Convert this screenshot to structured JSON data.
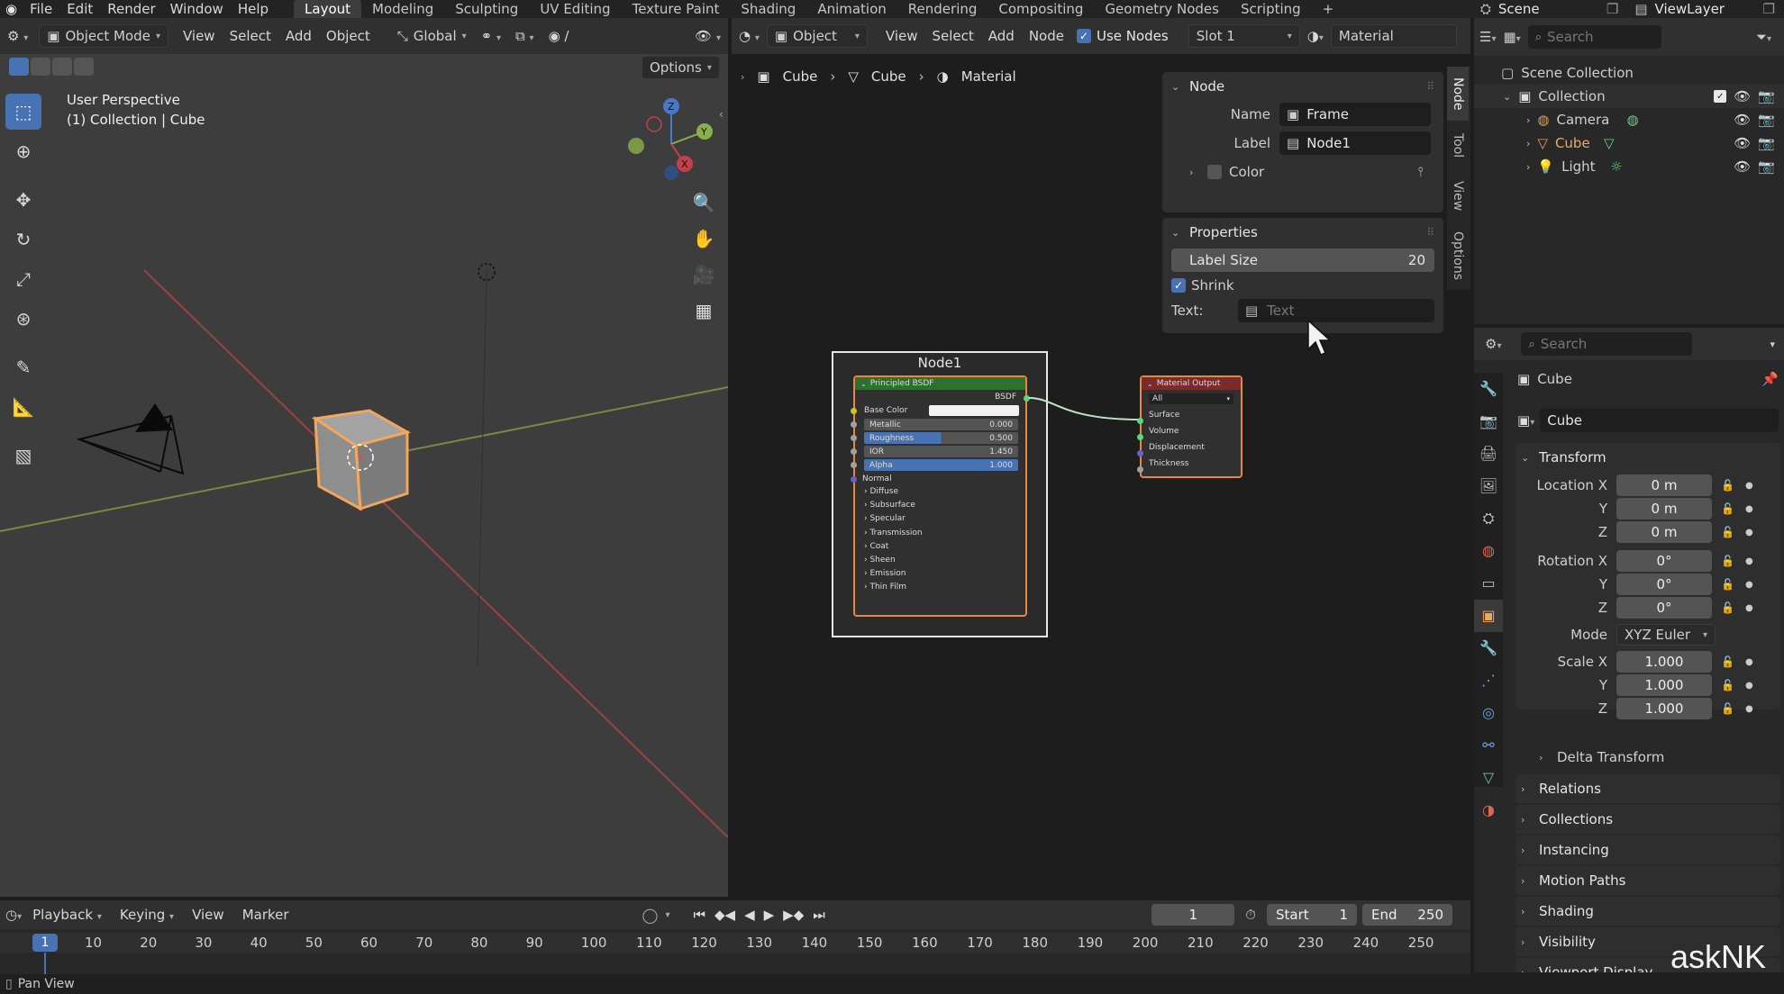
{
  "topbar": {
    "menus": [
      "File",
      "Edit",
      "Render",
      "Window",
      "Help"
    ],
    "workspaces": [
      "Layout",
      "Modeling",
      "Sculpting",
      "UV Editing",
      "Texture Paint",
      "Shading",
      "Animation",
      "Rendering",
      "Compositing",
      "Geometry Nodes",
      "Scripting"
    ],
    "active_workspace": "Layout",
    "scene": "Scene",
    "view_layer": "ViewLayer"
  },
  "viewport": {
    "mode": "Object Mode",
    "menus": [
      "View",
      "Select",
      "Add",
      "Object"
    ],
    "transform_orientation": "Global",
    "options_label": "Options",
    "info_line1": "User Perspective",
    "info_line2": "(1) Collection | Cube",
    "gizmo_axes": {
      "x": "X",
      "y": "Y",
      "z": "Z"
    }
  },
  "node_editor": {
    "type_dropdown": "Object",
    "menus": [
      "View",
      "Select",
      "Add",
      "Node"
    ],
    "use_nodes_label": "Use Nodes",
    "slot": "Slot 1",
    "material": "Material",
    "breadcrumb": [
      "Cube",
      "Cube",
      "Material"
    ],
    "sidebar_tabs": [
      "Node",
      "Tool",
      "View",
      "Options"
    ],
    "node_panel": {
      "title": "Node",
      "name_label": "Name",
      "name_value": "Frame",
      "label_label": "Label",
      "label_value": "Node1",
      "color_label": "Color"
    },
    "properties_panel": {
      "title": "Properties",
      "label_size_label": "Label Size",
      "label_size_value": "20",
      "shrink_label": "Shrink",
      "text_label": "Text:",
      "text_placeholder": "Text"
    },
    "frame_node": {
      "label": "Node1"
    },
    "bsdf_node": {
      "title": "Principled BSDF",
      "output": "BSDF",
      "inputs": [
        {
          "label": "Base Color",
          "value": ""
        },
        {
          "label": "Metallic",
          "value": "0.000"
        },
        {
          "label": "Roughness",
          "value": "0.500"
        },
        {
          "label": "IOR",
          "value": "1.450"
        },
        {
          "label": "Alpha",
          "value": "1.000"
        }
      ],
      "normal": "Normal",
      "sections": [
        "Diffuse",
        "Subsurface",
        "Specular",
        "Transmission",
        "Coat",
        "Sheen",
        "Emission",
        "Thin Film"
      ]
    },
    "output_node": {
      "title": "Material Output",
      "target": "All",
      "inputs": [
        "Surface",
        "Volume",
        "Displacement",
        "Thickness"
      ]
    }
  },
  "outliner": {
    "search_placeholder": "Search",
    "scene_collection": "Scene Collection",
    "collection": "Collection",
    "items": [
      "Camera",
      "Cube",
      "Light"
    ]
  },
  "properties_editor": {
    "search_placeholder": "Search",
    "object_name": "Cube",
    "datablock_name": "Cube",
    "transform_title": "Transform",
    "location": {
      "label": "Location X",
      "x": "0 m",
      "y": "0 m",
      "z": "0 m"
    },
    "rotation": {
      "label": "Rotation X",
      "x": "0°",
      "y": "0°",
      "z": "0°"
    },
    "mode_label": "Mode",
    "mode_value": "XYZ Euler",
    "scale": {
      "label": "Scale X",
      "x": "1.000",
      "y": "1.000",
      "z": "1.000"
    },
    "axis_labels": {
      "y": "Y",
      "z": "Z"
    },
    "delta_transform": "Delta Transform",
    "panels": [
      "Relations",
      "Collections",
      "Instancing",
      "Motion Paths",
      "Shading",
      "Visibility",
      "Viewport Display"
    ]
  },
  "timeline": {
    "menus": [
      "Playback",
      "Keying",
      "View",
      "Marker"
    ],
    "current_frame": "1",
    "start_label": "Start",
    "start_value": "1",
    "end_label": "End",
    "end_value": "250",
    "ruler": [
      "10",
      "20",
      "30",
      "40",
      "50",
      "60",
      "70",
      "80",
      "90",
      "100",
      "110",
      "120",
      "130",
      "140",
      "150",
      "160",
      "170",
      "180",
      "190",
      "200",
      "210",
      "220",
      "230",
      "240",
      "250"
    ],
    "ruler_current": "1"
  },
  "statusbar": {
    "text": "Pan View"
  },
  "watermark": "askNK"
}
